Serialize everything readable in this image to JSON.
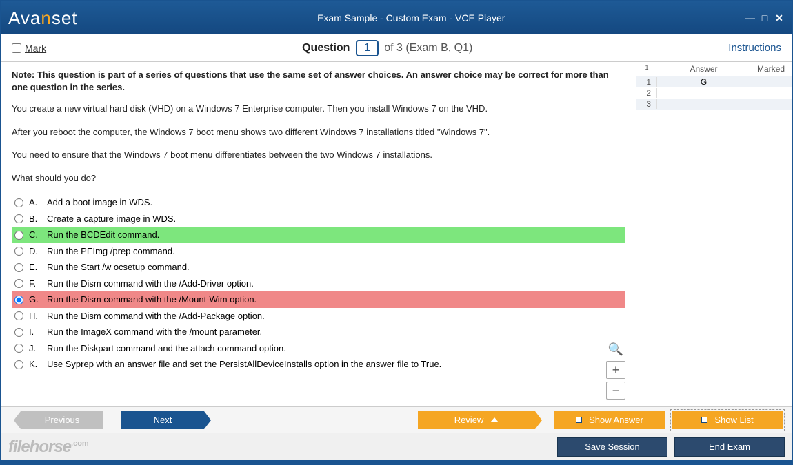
{
  "header": {
    "logo_a": "Ava",
    "logo_n": "n",
    "logo_s": "set",
    "title": "Exam Sample - Custom Exam - VCE Player"
  },
  "qbar": {
    "mark_label": "Mark",
    "question_label": "Question",
    "qnum": "1",
    "of_text": "of 3 (Exam B, Q1)",
    "instructions": "Instructions"
  },
  "question": {
    "note": "Note: This question is part of a series of questions that use the same set of answer choices. An answer choice may be correct for more than one question in the series.",
    "p1": "You create a new virtual hard disk (VHD) on a Windows 7 Enterprise computer. Then you install Windows 7 on the VHD.",
    "p2": "After you reboot the computer, the Windows 7 boot menu shows two different Windows 7 installations titled \"Windows 7\".",
    "p3": "You need to ensure that the Windows 7 boot menu differentiates between the two Windows 7 installations.",
    "p4": "What should you do?",
    "choices": [
      {
        "letter": "A.",
        "text": "Add a boot image in WDS.",
        "state": ""
      },
      {
        "letter": "B.",
        "text": "Create a capture image in WDS.",
        "state": ""
      },
      {
        "letter": "C.",
        "text": "Run the BCDEdit command.",
        "state": "correct"
      },
      {
        "letter": "D.",
        "text": "Run the PEImg /prep command.",
        "state": ""
      },
      {
        "letter": "E.",
        "text": "Run the Start /w ocsetup command.",
        "state": ""
      },
      {
        "letter": "F.",
        "text": "Run the Dism command with the /Add-Driver option.",
        "state": ""
      },
      {
        "letter": "G.",
        "text": "Run the Dism command with the /Mount-Wim option.",
        "state": "wrong"
      },
      {
        "letter": "H.",
        "text": "Run the Dism command with the /Add-Package option.",
        "state": ""
      },
      {
        "letter": "I.",
        "text": "Run the ImageX command with the /mount parameter.",
        "state": ""
      },
      {
        "letter": "J.",
        "text": "Run the Diskpart command and the attach command option.",
        "state": ""
      },
      {
        "letter": "K.",
        "text": "Use Syprep with an answer file and set the PersistAllDeviceInstalls option in the answer file to True.",
        "state": ""
      }
    ]
  },
  "side": {
    "header": {
      "idx": "1",
      "answer": "Answer",
      "marked": "Marked"
    },
    "rows": [
      {
        "n": "1",
        "a": "G",
        "m": ""
      },
      {
        "n": "2",
        "a": "",
        "m": ""
      },
      {
        "n": "3",
        "a": "",
        "m": ""
      }
    ]
  },
  "nav": {
    "previous": "Previous",
    "next": "Next",
    "review": "Review",
    "show_answer": "Show Answer",
    "show_list": "Show List"
  },
  "bottom": {
    "save": "Save Session",
    "end": "End Exam",
    "fh": "filehorse",
    "fhcom": ".com"
  }
}
